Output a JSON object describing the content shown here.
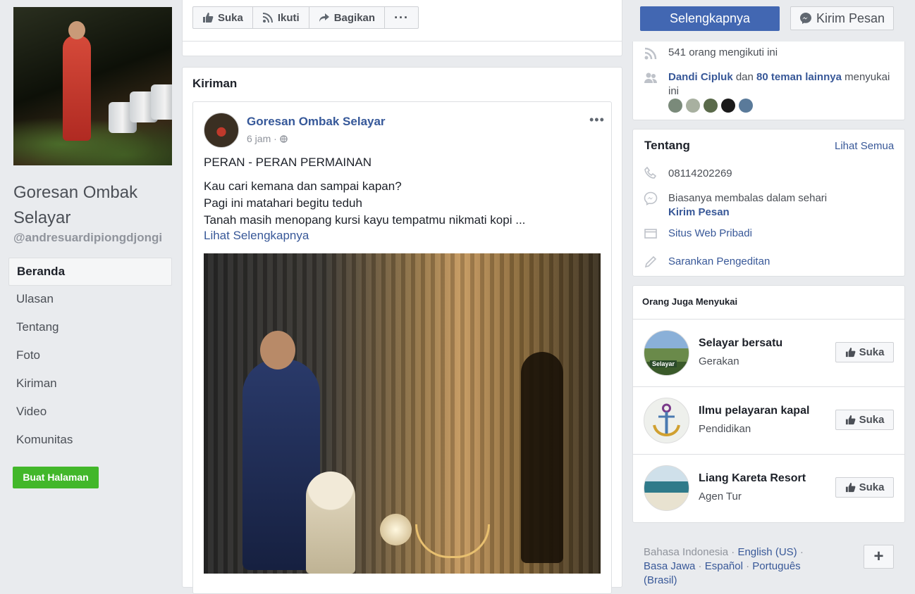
{
  "page": {
    "name": "Goresan Ombak Selayar",
    "handle": "@andresuardipiongdjongi",
    "create_button": "Buat Halaman"
  },
  "nav": {
    "items": [
      {
        "label": "Beranda",
        "active": true
      },
      {
        "label": "Ulasan"
      },
      {
        "label": "Tentang"
      },
      {
        "label": "Foto"
      },
      {
        "label": "Kiriman"
      },
      {
        "label": "Video"
      },
      {
        "label": "Komunitas"
      }
    ]
  },
  "actions": {
    "like": "Suka",
    "follow": "Ikuti",
    "share": "Bagikan",
    "more": "···",
    "primary": "Selengkapnya",
    "message": "Kirim Pesan"
  },
  "posts": {
    "section_title": "Kiriman",
    "post": {
      "author": "Goresan Ombak Selayar",
      "time": "6 jam",
      "title": "PERAN - PERAN PERMAINAN",
      "lines": [
        "Kau cari kemana dan sampai kapan?",
        "Pagi ini matahari begitu teduh",
        "Tanah masih menopang kursi kayu tempatmu nikmati kopi ..."
      ],
      "see_more": "Lihat Selengkapnya",
      "more": "•••"
    }
  },
  "community": {
    "followers": "541 orang mengikuti ini",
    "likes_friend": "Dandi Cipluk",
    "likes_and": "dan",
    "likes_others": "80 teman lainnya",
    "likes_suffix": "menyukai ini",
    "friend_colors": [
      "#7a8a7a",
      "#a8b0a0",
      "#5a6a4a",
      "#1a1a1a",
      "#5a7a9a"
    ]
  },
  "about": {
    "title": "Tentang",
    "see_all": "Lihat Semua",
    "phone": "08114202269",
    "response": "Biasanya membalas dalam sehari",
    "send_message": "Kirim Pesan",
    "website": "Situs Web Pribadi",
    "suggest": "Sarankan Pengeditan"
  },
  "suggestions": {
    "title": "Orang Juga Menyukai",
    "like_label": "Suka",
    "items": [
      {
        "name": "Selayar bersatu",
        "category": "Gerakan",
        "badge": "Selayar"
      },
      {
        "name": "Ilmu pelayaran kapal",
        "category": "Pendidikan"
      },
      {
        "name": "Liang Kareta Resort",
        "category": "Agen Tur"
      }
    ]
  },
  "footer": {
    "lang_current": "Bahasa Indonesia",
    "lang_1": "English (US)",
    "lang_2": "Basa Jawa",
    "lang_3": "Español",
    "lang_4": "Português (Brasil)",
    "sep": "·",
    "plus": "+"
  }
}
